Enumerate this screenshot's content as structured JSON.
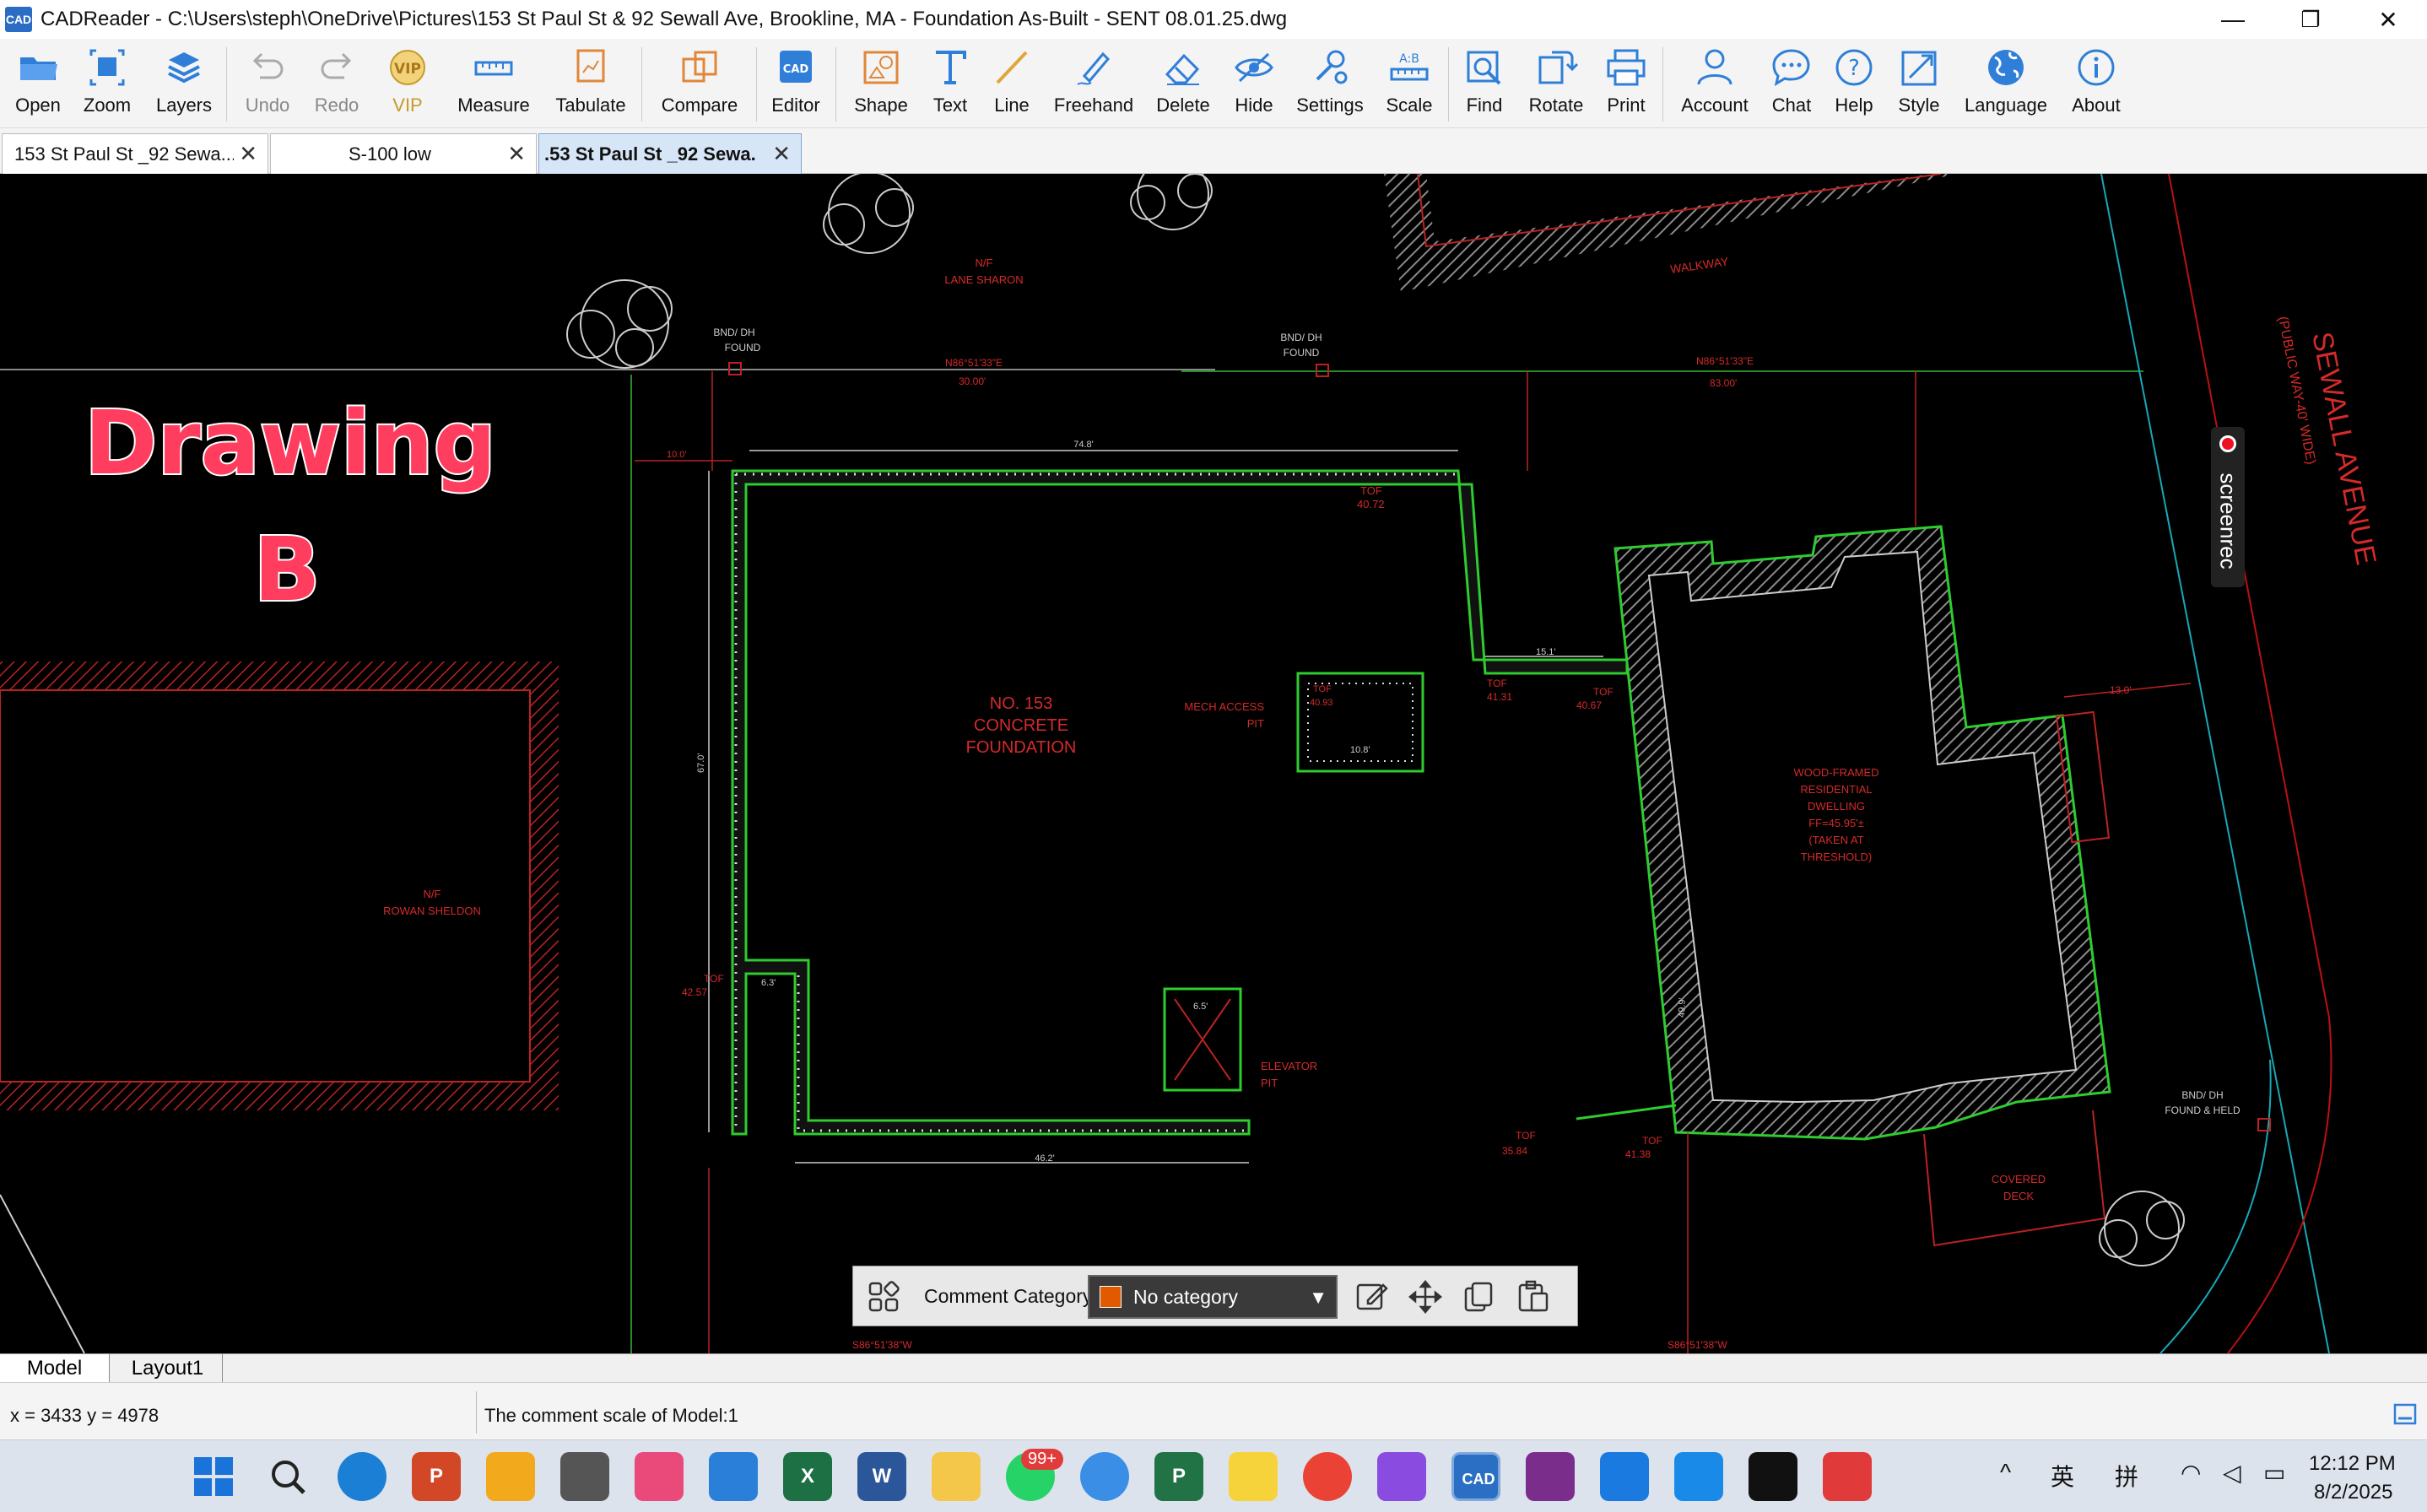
{
  "window": {
    "title": "CADReader - C:\\Users\\steph\\OneDrive\\Pictures\\153 St Paul St & 92 Sewall Ave, Brookline, MA - Foundation As-Built - SENT 08.01.25.dwg",
    "app_icon": "CAD",
    "minimize": "—",
    "maximize": "❐",
    "close": "✕"
  },
  "toolbar": {
    "items": [
      {
        "label": "Open",
        "icon": "folder-icon"
      },
      {
        "label": "Zoom",
        "icon": "zoom-icon"
      },
      {
        "label": "Layers",
        "icon": "layers-icon"
      },
      {
        "label": "Undo",
        "icon": "undo-icon"
      },
      {
        "label": "Redo",
        "icon": "redo-icon"
      },
      {
        "label": "VIP",
        "icon": "vip-icon"
      },
      {
        "label": "Measure",
        "icon": "measure-icon"
      },
      {
        "label": "Tabulate",
        "icon": "tabulate-icon"
      },
      {
        "label": "Compare",
        "icon": "compare-icon"
      },
      {
        "label": "Editor",
        "icon": "editor-icon"
      },
      {
        "label": "Shape",
        "icon": "shape-icon"
      },
      {
        "label": "Text",
        "icon": "text-icon"
      },
      {
        "label": "Line",
        "icon": "line-icon"
      },
      {
        "label": "Freehand",
        "icon": "freehand-icon"
      },
      {
        "label": "Delete",
        "icon": "eraser-icon"
      },
      {
        "label": "Hide",
        "icon": "hide-icon"
      },
      {
        "label": "Settings",
        "icon": "settings-icon"
      },
      {
        "label": "Scale",
        "icon": "scale-icon"
      },
      {
        "label": "Find",
        "icon": "find-icon"
      },
      {
        "label": "Rotate",
        "icon": "rotate-icon"
      },
      {
        "label": "Print",
        "icon": "print-icon"
      },
      {
        "label": "Account",
        "icon": "account-icon"
      },
      {
        "label": "Chat",
        "icon": "chat-icon"
      },
      {
        "label": "Help",
        "icon": "help-icon"
      },
      {
        "label": "Style",
        "icon": "style-icon"
      },
      {
        "label": "Language",
        "icon": "globe-icon"
      },
      {
        "label": "About",
        "icon": "info-icon"
      }
    ]
  },
  "tabs": [
    {
      "label": "153 St Paul St _92 Sewa...",
      "active": false
    },
    {
      "label": "S-100 low",
      "active": false
    },
    {
      "label": ".53 St Paul St _92 Sewa.",
      "active": true
    }
  ],
  "tab_close": "✕",
  "drawing": {
    "overlay_line1": "Drawing",
    "overlay_line2": "B",
    "labels": {
      "street": "SEWALL AVENUE",
      "street_sub": "(PUBLIC WAY-40' WIDE)",
      "walkway": "WALKWAY",
      "abutter_top": "N/F",
      "abutter_top_name": "LANE SHARON",
      "abutter_left": "N/F",
      "abutter_left_name": "ROWAN SHELDON",
      "bnd1": "BND/ DH",
      "bnd1b": "FOUND",
      "bnd2": "BND/ DH",
      "bnd2b": "FOUND",
      "bnd3": "BND/ DH",
      "bnd3b": "FOUND & HELD",
      "bearing1": "N86°51'33\"E",
      "dist1": "30.00'",
      "bearing2": "N86°51'33\"E",
      "dist2": "83.00'",
      "bearing3": "S86°51'38\"W",
      "bearing4": "S86°51'38\"W",
      "foundation_line1": "NO. 153",
      "foundation_line2": "CONCRETE",
      "foundation_line3": "FOUNDATION",
      "mech_line1": "MECH ACCESS",
      "mech_line2": "PIT",
      "elev_line1": "ELEVATOR",
      "elev_line2": "PIT",
      "dwell_line1": "WOOD-FRAMED",
      "dwell_line2": "RESIDENTIAL",
      "dwell_line3": "DWELLING",
      "dwell_line4": "FF=45.95'±",
      "dwell_line5": "(TAKEN AT",
      "dwell_line6": "THRESHOLD)",
      "deck_line1": "COVERED",
      "deck_line2": "DECK",
      "tof": "TOF",
      "tof1": "40.72",
      "tof2": "41.31",
      "tof3": "40.67",
      "tof4": "35.84",
      "tof5": "41.38",
      "tof6": "40.93",
      "tof7": "42.57",
      "dim_74": "74.8'",
      "dim_67": "67.0'",
      "dim_46": "46.2'",
      "dim_15": "15.1'",
      "dim_10": "10.0'",
      "dim_108": "10.8'",
      "dim_65": "6.5'",
      "dim_63": "6.3'",
      "dim_13": "13.0'",
      "dim_49": "49.9'"
    }
  },
  "screenrec": {
    "label": "screenrec"
  },
  "comment_bar": {
    "label": "Comment Category",
    "category": "No category",
    "category_color": "#e15a00"
  },
  "layout_tabs": {
    "model": "Model",
    "layout1": "Layout1"
  },
  "status": {
    "coords": "x = 3433 y = 4978",
    "comment_scale": "The comment scale of Model:1"
  },
  "taskbar": {
    "badge": "99+",
    "ime1": "英",
    "ime2": "拼",
    "time": "12:12 PM",
    "date": "8/2/2025"
  }
}
